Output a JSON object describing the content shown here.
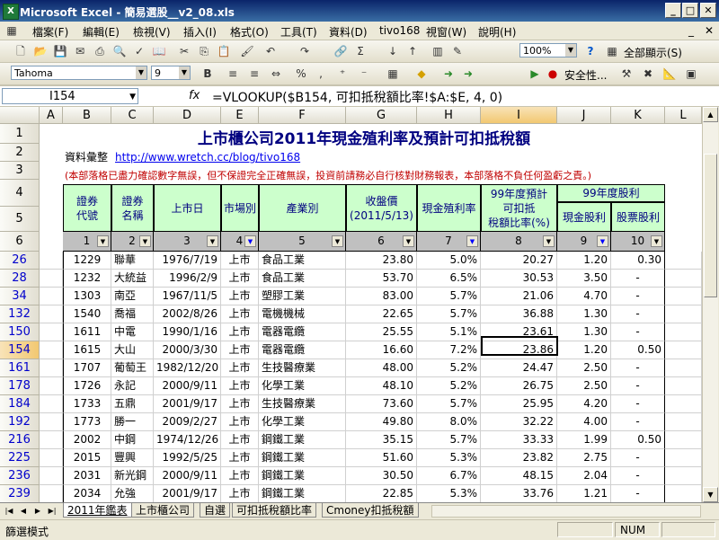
{
  "window": {
    "title": "Microsoft Excel - 簡易選股__v2_08.xls",
    "app_icon": "X",
    "buttons": {
      "min": "_",
      "max": "□",
      "close": "✕"
    }
  },
  "menu": {
    "items": [
      "檔案(F)",
      "編輯(E)",
      "檢視(V)",
      "插入(I)",
      "格式(O)",
      "工具(T)",
      "資料(D)",
      "tivo168",
      "視窗(W)",
      "說明(H)"
    ],
    "doc_min": "_",
    "doc_close": "✕"
  },
  "toolbar1": {
    "zoom": "100%",
    "show_all": "全部顯示(S)",
    "help_icon": "?"
  },
  "toolbar2": {
    "font": "Tahoma",
    "size": "9",
    "bold": "B",
    "security": "安全性..."
  },
  "formula_bar": {
    "name_box": "I154",
    "fx": "fx",
    "formula": "=VLOOKUP($B154, 可扣抵稅額比率!$A:$E, 4, 0)"
  },
  "columns": [
    "A",
    "B",
    "C",
    "D",
    "E",
    "F",
    "G",
    "H",
    "I",
    "J",
    "K",
    "L"
  ],
  "header_rows": [
    "1",
    "2",
    "3",
    "4",
    "5",
    "6"
  ],
  "sheet_title": "上市櫃公司2011年現金殖利率及預計可扣抵稅額",
  "source_label": "資料彙整",
  "source_url": "http://www.wretch.cc/blog/tivo168",
  "disclaimer": "(本部落格已盡力確認數字無誤，但不保證完全正確無誤，投資前請務必自行核對財務報表，本部落格不負任何盈虧之責。)",
  "table_headers": {
    "code": "證券\n代號",
    "name": "證券\n名稱",
    "listed": "上市日",
    "market": "市場別",
    "industry": "產業別",
    "close": "收盤價\n(2011/5/13)",
    "yield": "現金殖利率",
    "credit": "99年度預計\n可扣抵\n稅額比率(%)",
    "dividend_group": "99年度股利",
    "cash_div": "現金股利",
    "stock_div": "股票股利"
  },
  "filter_row": [
    "1",
    "2",
    "3",
    "4",
    "5",
    "6",
    "7",
    "8",
    "9",
    "10"
  ],
  "filter_active": [
    false,
    false,
    false,
    true,
    false,
    false,
    true,
    false,
    true,
    false
  ],
  "rows": [
    {
      "row": "26",
      "code": "1229",
      "name": "聯華",
      "date": "1976/7/19",
      "market": "上市",
      "industry": "食品工業",
      "close": "23.80",
      "yield": "5.0%",
      "credit": "20.27",
      "cash": "1.20",
      "stock": "0.30"
    },
    {
      "row": "28",
      "code": "1232",
      "name": "大統益",
      "date": "1996/2/9",
      "market": "上市",
      "industry": "食品工業",
      "close": "53.70",
      "yield": "6.5%",
      "credit": "30.53",
      "cash": "3.50",
      "stock": "-"
    },
    {
      "row": "34",
      "code": "1303",
      "name": "南亞",
      "date": "1967/11/5",
      "market": "上市",
      "industry": "塑膠工業",
      "close": "83.00",
      "yield": "5.7%",
      "credit": "21.06",
      "cash": "4.70",
      "stock": "-"
    },
    {
      "row": "132",
      "code": "1540",
      "name": "喬福",
      "date": "2002/8/26",
      "market": "上市",
      "industry": "電機機械",
      "close": "22.65",
      "yield": "5.7%",
      "credit": "36.88",
      "cash": "1.30",
      "stock": "-"
    },
    {
      "row": "150",
      "code": "1611",
      "name": "中電",
      "date": "1990/1/16",
      "market": "上市",
      "industry": "電器電纜",
      "close": "25.55",
      "yield": "5.1%",
      "credit": "23.61",
      "cash": "1.30",
      "stock": "-"
    },
    {
      "row": "154",
      "code": "1615",
      "name": "大山",
      "date": "2000/3/30",
      "market": "上市",
      "industry": "電器電纜",
      "close": "16.60",
      "yield": "7.2%",
      "credit": "23.86",
      "cash": "1.20",
      "stock": "0.50"
    },
    {
      "row": "161",
      "code": "1707",
      "name": "葡萄王",
      "date": "1982/12/20",
      "market": "上市",
      "industry": "生技醫療業",
      "close": "48.00",
      "yield": "5.2%",
      "credit": "24.47",
      "cash": "2.50",
      "stock": "-"
    },
    {
      "row": "178",
      "code": "1726",
      "name": "永記",
      "date": "2000/9/11",
      "market": "上市",
      "industry": "化學工業",
      "close": "48.10",
      "yield": "5.2%",
      "credit": "26.75",
      "cash": "2.50",
      "stock": "-"
    },
    {
      "row": "184",
      "code": "1733",
      "name": "五鼎",
      "date": "2001/9/17",
      "market": "上市",
      "industry": "生技醫療業",
      "close": "73.60",
      "yield": "5.7%",
      "credit": "25.95",
      "cash": "4.20",
      "stock": "-"
    },
    {
      "row": "192",
      "code": "1773",
      "name": "勝一",
      "date": "2009/2/27",
      "market": "上市",
      "industry": "化學工業",
      "close": "49.80",
      "yield": "8.0%",
      "credit": "32.22",
      "cash": "4.00",
      "stock": "-"
    },
    {
      "row": "216",
      "code": "2002",
      "name": "中鋼",
      "date": "1974/12/26",
      "market": "上市",
      "industry": "鋼鐵工業",
      "close": "35.15",
      "yield": "5.7%",
      "credit": "33.33",
      "cash": "1.99",
      "stock": "0.50"
    },
    {
      "row": "225",
      "code": "2015",
      "name": "豐興",
      "date": "1992/5/25",
      "market": "上市",
      "industry": "鋼鐵工業",
      "close": "51.60",
      "yield": "5.3%",
      "credit": "23.82",
      "cash": "2.75",
      "stock": "-"
    },
    {
      "row": "236",
      "code": "2031",
      "name": "新光鋼",
      "date": "2000/9/11",
      "market": "上市",
      "industry": "鋼鐵工業",
      "close": "30.50",
      "yield": "6.7%",
      "credit": "48.15",
      "cash": "2.04",
      "stock": "-"
    },
    {
      "row": "239",
      "code": "2034",
      "name": "允強",
      "date": "2001/9/17",
      "market": "上市",
      "industry": "鋼鐵工業",
      "close": "22.85",
      "yield": "5.3%",
      "credit": "33.76",
      "cash": "1.21",
      "stock": "-"
    },
    {
      "row": "245",
      "code": "2062",
      "name": "橋椿",
      "date": "2007/11/16",
      "market": "上市",
      "industry": "其他",
      "close": "37.20",
      "yield": "9.4%",
      "credit": "21.94",
      "cash": "3.50",
      "stock": "-"
    }
  ],
  "tabs": [
    "2011年鑑表",
    "上市櫃公司",
    "自選",
    "可扣抵稅額比率",
    "Cmoney扣抵稅額"
  ],
  "tab_nav": [
    "|◀",
    "◀",
    "▶",
    "▶|"
  ],
  "status": {
    "mode": "篩選模式",
    "num": "NUM"
  }
}
